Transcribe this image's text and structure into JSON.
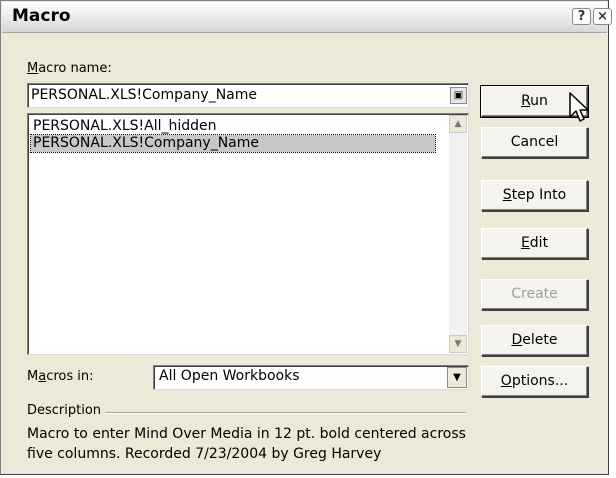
{
  "window": {
    "title": "Macro",
    "help_label": "?",
    "close_label": "×"
  },
  "macro_name": {
    "label_prefix": "",
    "label_key": "M",
    "label_rest": "acro name:",
    "value": "PERSONAL.XLS!Company_Name"
  },
  "macro_list": {
    "items": [
      "PERSONAL.XLS!All_hidden",
      "PERSONAL.XLS!Company_Name"
    ],
    "selected_index": 1
  },
  "macros_in": {
    "label_prefix": "M",
    "label_key": "a",
    "label_rest": "cros in:",
    "value": "All Open Workbooks"
  },
  "description": {
    "label": "Description",
    "text": "Macro to enter Mind Over Media in 12 pt. bold centered across five columns. Recorded 7/23/2004 by Greg Harvey"
  },
  "buttons": {
    "run": {
      "prefix": "",
      "key": "R",
      "rest": "un"
    },
    "cancel": {
      "label": "Cancel"
    },
    "step_into": {
      "prefix": "",
      "key": "S",
      "rest": "tep Into"
    },
    "edit": {
      "prefix": "",
      "key": "E",
      "rest": "dit"
    },
    "create": {
      "prefix": "",
      "key": "",
      "rest": "Create"
    },
    "delete": {
      "prefix": "",
      "key": "D",
      "rest": "elete"
    },
    "options": {
      "prefix": "",
      "key": "O",
      "rest": "ptions..."
    }
  },
  "icons": {
    "collapse": "collapse-dialog-icon",
    "scroll_up": "scroll-up-icon",
    "scroll_down": "scroll-down-icon",
    "dropdown": "chevron-down-icon",
    "cursor": "mouse-pointer-icon"
  }
}
